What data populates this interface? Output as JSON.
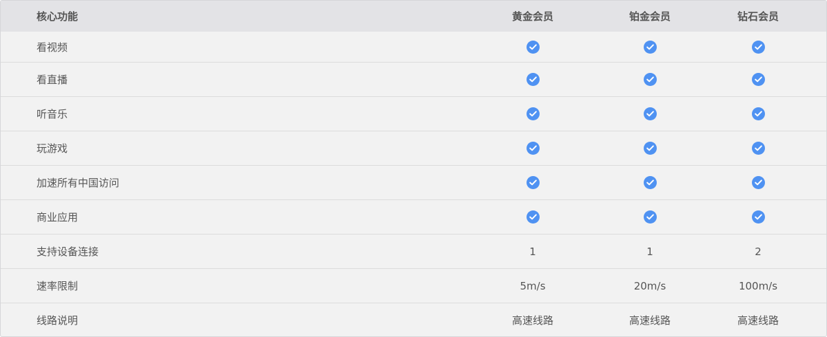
{
  "header": {
    "feature_label": "核心功能",
    "plans": [
      "黄金会员",
      "铂金会员",
      "钻石会员"
    ]
  },
  "icons": {
    "check": "check-circle-icon",
    "check_color": "#4f92f2"
  },
  "rows": [
    {
      "feature": "看视频",
      "values": [
        true,
        true,
        true
      ]
    },
    {
      "feature": "看直播",
      "values": [
        true,
        true,
        true
      ]
    },
    {
      "feature": "听音乐",
      "values": [
        true,
        true,
        true
      ]
    },
    {
      "feature": "玩游戏",
      "values": [
        true,
        true,
        true
      ]
    },
    {
      "feature": "加速所有中国访问",
      "values": [
        true,
        true,
        true
      ]
    },
    {
      "feature": "商业应用",
      "values": [
        true,
        true,
        true
      ]
    },
    {
      "feature": "支持设备连接",
      "values": [
        "1",
        "1",
        "2"
      ]
    },
    {
      "feature": "速率限制",
      "values": [
        "5m/s",
        "20m/s",
        "100m/s"
      ]
    },
    {
      "feature": "线路说明",
      "values": [
        "高速线路",
        "高速线路",
        "高速线路"
      ]
    }
  ]
}
